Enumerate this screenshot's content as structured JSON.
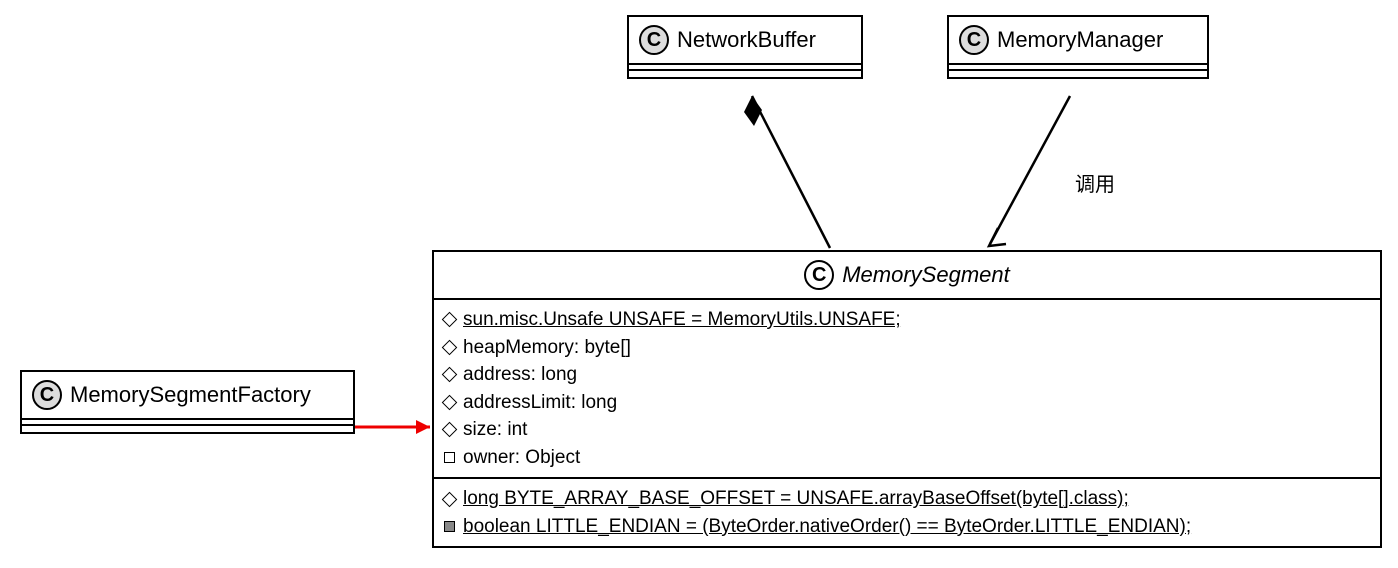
{
  "classes": {
    "networkBuffer": {
      "name": "NetworkBuffer",
      "stereotype": "C"
    },
    "memoryManager": {
      "name": "MemoryManager",
      "stereotype": "C"
    },
    "memorySegmentFactory": {
      "name": "MemorySegmentFactory",
      "stereotype": "C"
    },
    "memorySegment": {
      "name": "MemorySegment",
      "stereotype": "C",
      "abstract": true,
      "attributes": [
        {
          "vis": "diamond",
          "text": "sun.misc.Unsafe UNSAFE = MemoryUtils.UNSAFE;",
          "static": true
        },
        {
          "vis": "diamond",
          "text": "heapMemory: byte[]",
          "static": false
        },
        {
          "vis": "diamond",
          "text": "address: long",
          "static": false
        },
        {
          "vis": "diamond",
          "text": "addressLimit: long",
          "static": false
        },
        {
          "vis": "diamond",
          "text": "size: int",
          "static": false
        },
        {
          "vis": "square",
          "text": "owner: Object",
          "static": false
        }
      ],
      "statics": [
        {
          "vis": "diamond",
          "text": "long BYTE_ARRAY_BASE_OFFSET = UNSAFE.arrayBaseOffset(byte[].class);",
          "static": true
        },
        {
          "vis": "square-filled",
          "text": "boolean LITTLE_ENDIAN = (ByteOrder.nativeOrder() == ByteOrder.LITTLE_ENDIAN);",
          "static": true
        }
      ]
    }
  },
  "relationships": {
    "memoryManager_to_memorySegment_label": "调用"
  },
  "chart_data": {
    "type": "uml-class-diagram",
    "classes": [
      {
        "id": "NetworkBuffer",
        "kind": "class"
      },
      {
        "id": "MemoryManager",
        "kind": "class"
      },
      {
        "id": "MemorySegmentFactory",
        "kind": "class"
      },
      {
        "id": "MemorySegment",
        "kind": "abstract-class",
        "attributes": [
          "sun.misc.Unsafe UNSAFE = MemoryUtils.UNSAFE;",
          "heapMemory: byte[]",
          "address: long",
          "addressLimit: long",
          "size: int",
          "owner: Object"
        ],
        "static_members": [
          "long BYTE_ARRAY_BASE_OFFSET = UNSAFE.arrayBaseOffset(byte[].class);",
          "boolean LITTLE_ENDIAN = (ByteOrder.nativeOrder() == ByteOrder.LITTLE_ENDIAN);"
        ]
      }
    ],
    "relationships": [
      {
        "from": "NetworkBuffer",
        "to": "MemorySegment",
        "type": "composition"
      },
      {
        "from": "MemoryManager",
        "to": "MemorySegment",
        "type": "dependency",
        "label": "调用"
      },
      {
        "from": "MemorySegmentFactory",
        "to": "MemorySegment",
        "type": "dependency"
      }
    ]
  }
}
